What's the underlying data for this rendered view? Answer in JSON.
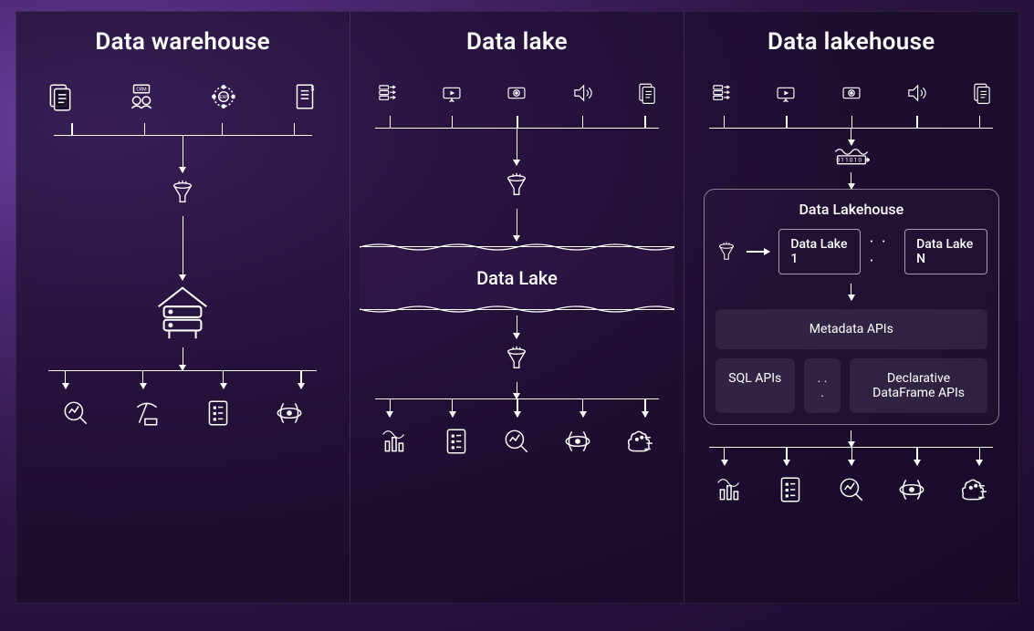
{
  "columns": {
    "warehouse": {
      "title": "Data warehouse",
      "sources": [
        "documents",
        "crm",
        "erp",
        "billing"
      ],
      "transform": "etl-funnel",
      "storage": "data-warehouse-building",
      "consumers": [
        "analytics-search",
        "mining",
        "reports",
        "ml-science"
      ]
    },
    "datalake": {
      "title": "Data lake",
      "sources": [
        "streaming-data",
        "video",
        "camera",
        "audio",
        "documents"
      ],
      "transform_in": "etl-funnel",
      "storage_label": "Data Lake",
      "transform_out": "etl-funnel",
      "consumers": [
        "bi-dashboards",
        "reports",
        "analytics-search",
        "ml-science",
        "ai"
      ]
    },
    "lakehouse": {
      "title": "Data lakehouse",
      "sources": [
        "streaming-data",
        "video",
        "camera",
        "audio",
        "documents"
      ],
      "preprocess": "stream-binary",
      "box_title": "Data Lakehouse",
      "ingest_funnel": "etl-funnel",
      "lakes": {
        "first": "Data Lake 1",
        "ellipsis": "· · ·",
        "last": "Data Lake N"
      },
      "metadata_api_label": "Metadata APIs",
      "sql_api_label": "SQL APIs",
      "api_ellipsis": ". . .",
      "df_api_label": "Declarative DataFrame APIs",
      "consumers": [
        "bi-dashboards",
        "reports",
        "analytics-search",
        "ml-science",
        "ai"
      ]
    }
  }
}
